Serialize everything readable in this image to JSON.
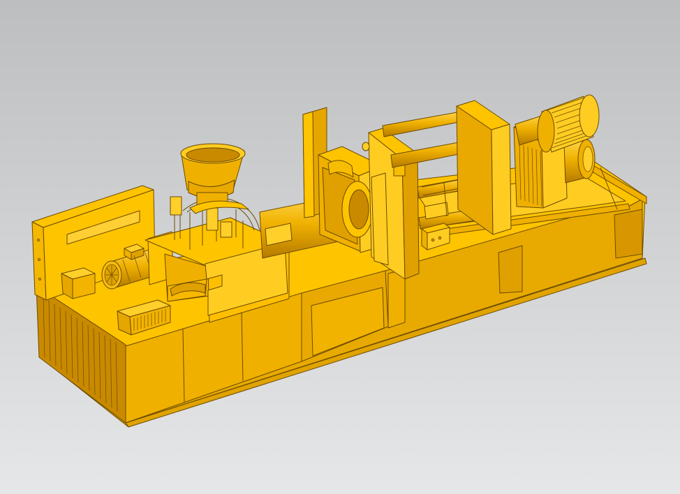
{
  "viewport": {
    "background_top": "#bdbebf",
    "background_bottom": "#e6e7e8"
  },
  "model": {
    "colors": {
      "light": "#ffc400",
      "mid": "#f0b100",
      "dark": "#c98a00",
      "deep": "#a86f00",
      "edge": "#6b4a00"
    },
    "parts": [
      "frame-base",
      "control-cabinet",
      "hopper",
      "injection-unit",
      "electric-motor",
      "heater-box",
      "fixed-platen",
      "moving-platen",
      "tie-bars",
      "clamp-cylinder",
      "rear-gear",
      "rail-frame"
    ]
  }
}
